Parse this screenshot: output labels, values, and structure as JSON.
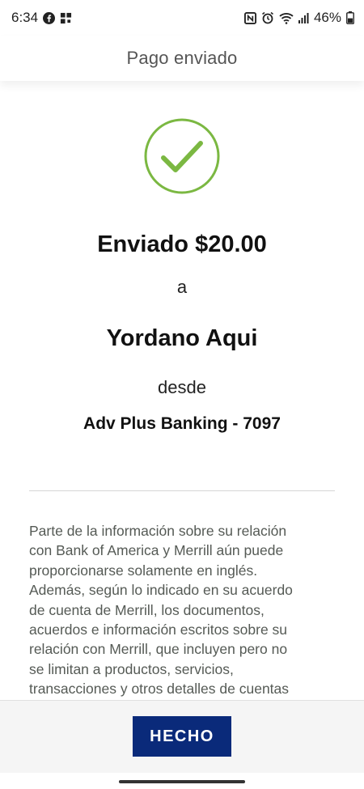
{
  "status_bar": {
    "time": "6:34",
    "battery": "46%",
    "left_icons": [
      "facebook-icon",
      "grid-app-icon"
    ],
    "right_icons": [
      "nfc-icon",
      "alarm-icon",
      "wifi-icon",
      "signal-icon",
      "battery-icon"
    ]
  },
  "header": {
    "title": "Pago enviado"
  },
  "confirmation": {
    "icon": "check-circle-icon",
    "icon_color": "#7bb842",
    "amount_text": "Enviado $20.00",
    "word_a": "a",
    "recipient": "Yordano Aqui",
    "word_desde": "desde",
    "account": "Adv Plus Banking - 7097"
  },
  "disclaimer": {
    "lines": [
      "Parte de la información sobre su relación",
      "con Bank of America y Merrill aún puede",
      "proporcionarse solamente en inglés.",
      "Además, según lo indicado en su acuerdo",
      "de cuenta de Merrill, los documentos,",
      "acuerdos e información escritos sobre su",
      "relación con Merrill, que incluyen pero no",
      "se limitan a productos, servicios,",
      "transacciones y otros detalles de cuentas"
    ]
  },
  "footer": {
    "done_label": "HECHO",
    "button_color": "#0a2a7a"
  }
}
